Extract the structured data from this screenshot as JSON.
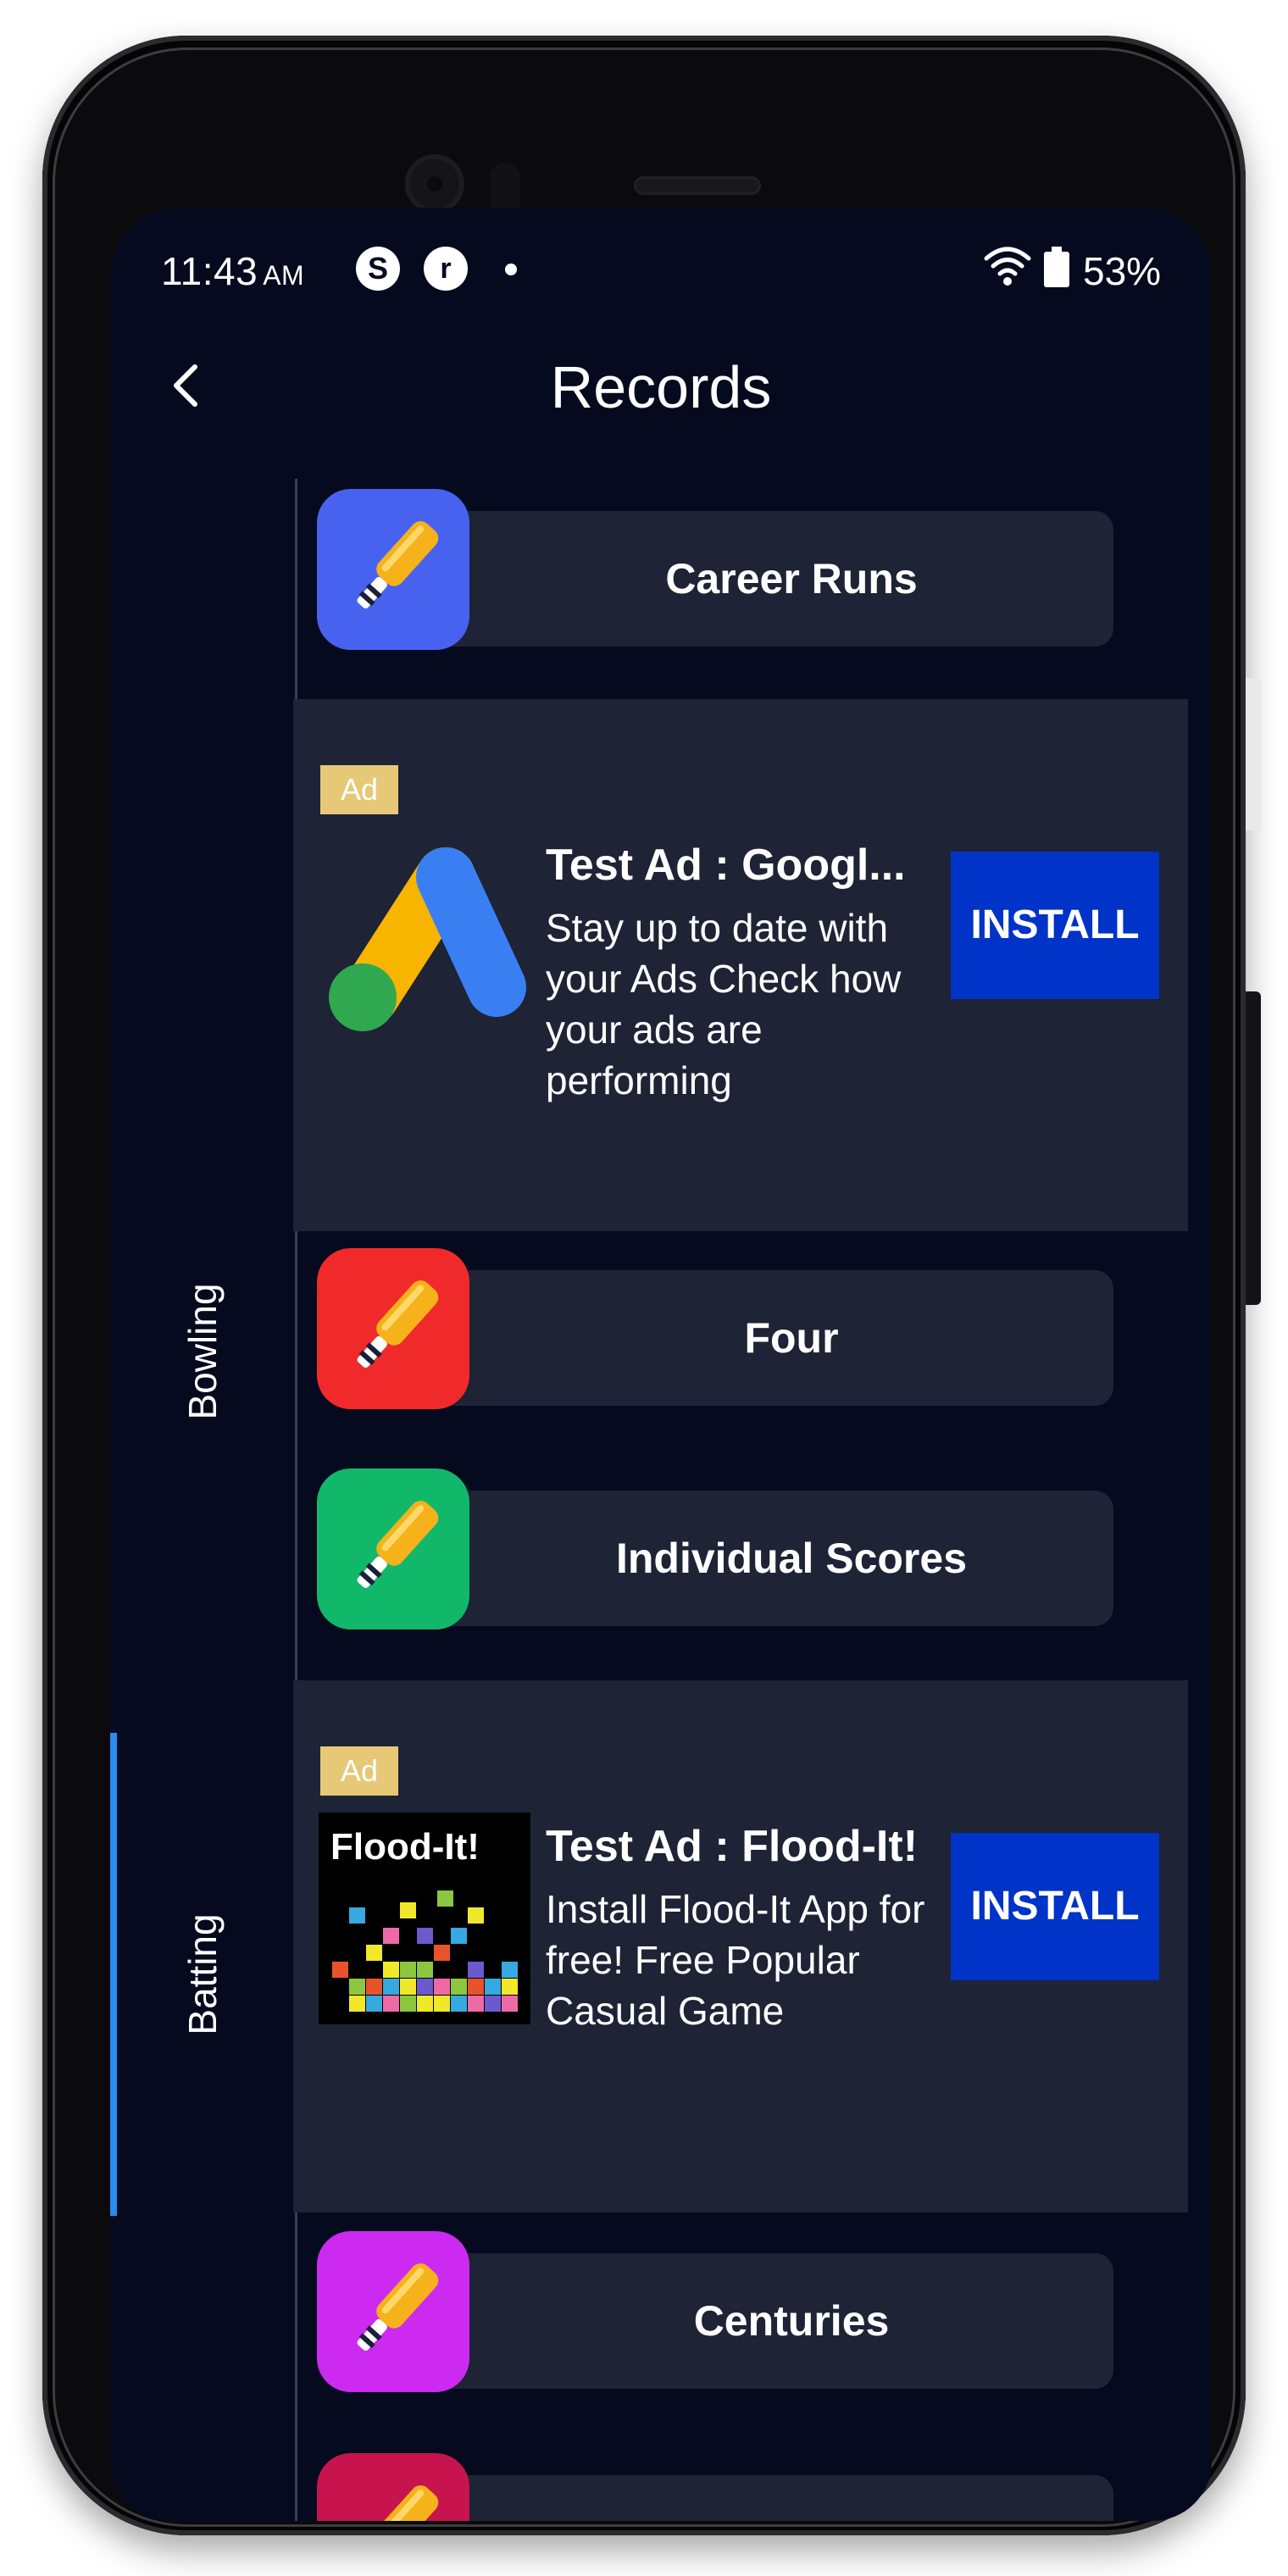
{
  "status_bar": {
    "time": "11:43",
    "ampm": "AM",
    "notif_icons": [
      "skype-icon",
      "r-app-icon"
    ],
    "battery": "53%"
  },
  "header": {
    "title": "Records"
  },
  "tabs": [
    {
      "label": "Bowling",
      "selected": false
    },
    {
      "label": "Batting",
      "selected": true
    }
  ],
  "records": [
    {
      "label": "Career Runs",
      "color": "#4862f0"
    },
    {
      "label": "Four",
      "color": "#f02a2a"
    },
    {
      "label": "Individual Scores",
      "color": "#12b86a"
    },
    {
      "label": "Centuries",
      "color": "#cc2af0"
    },
    {
      "label": "",
      "color": "#c8144e"
    }
  ],
  "ads": [
    {
      "badge": "Ad",
      "title": "Test Ad : Googl...",
      "body": "Stay up to date with your Ads Check how your ads are performing",
      "cta": "INSTALL"
    },
    {
      "badge": "Ad",
      "title": "Test Ad : Flood-It!",
      "body": "Install Flood-It App for free! Free Popular Casual Game",
      "cta": "INSTALL",
      "image_text": "Flood-It!"
    }
  ],
  "colors": {
    "background": "#050a1e",
    "card": "#1e2335",
    "install": "#0033c7",
    "ad_badge": "#e6c877",
    "tab_indicator": "#2b8cf0"
  }
}
